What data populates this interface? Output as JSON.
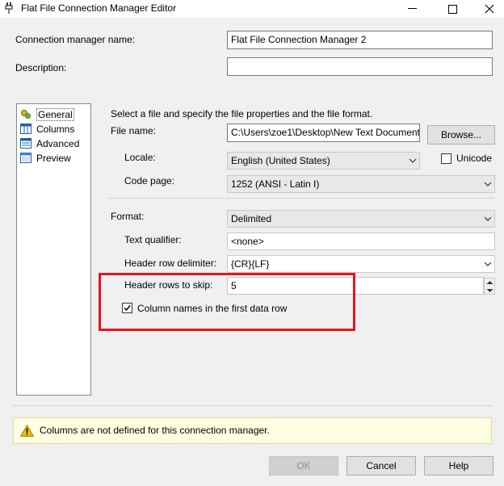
{
  "window": {
    "title": "Flat File Connection Manager Editor",
    "minimize_glyph": "—",
    "maximize_glyph": "☐",
    "close_glyph": "✕"
  },
  "form": {
    "name_label": "Connection manager name:",
    "name_value": "Flat File Connection Manager 2",
    "description_label": "Description:",
    "description_value": ""
  },
  "nav": {
    "items": [
      {
        "label": "General",
        "icon": "general-icon"
      },
      {
        "label": "Columns",
        "icon": "columns-icon"
      },
      {
        "label": "Advanced",
        "icon": "advanced-icon"
      },
      {
        "label": "Preview",
        "icon": "preview-icon"
      }
    ],
    "selected": "General"
  },
  "general": {
    "intro": "Select a file and specify the file properties and the file format.",
    "file_name_label": "File name:",
    "file_name_value": "C:\\Users\\zoe1\\Desktop\\New Text Document",
    "browse_label": "Browse...",
    "locale_label": "Locale:",
    "locale_value": "English (United States)",
    "unicode_label": "Unicode",
    "unicode_checked": false,
    "code_page_label": "Code page:",
    "code_page_value": "1252  (ANSI - Latin I)",
    "format_label": "Format:",
    "format_value": "Delimited",
    "text_qualifier_label": "Text qualifier:",
    "text_qualifier_value": "<none>",
    "header_row_delimiter_label": "Header row delimiter:",
    "header_row_delimiter_value": "{CR}{LF}",
    "header_rows_skip_label": "Header rows to skip:",
    "header_rows_skip_value": "5",
    "column_names_label": "Column names in the first data row",
    "column_names_checked": true
  },
  "warning": {
    "text": "Columns are not defined for this connection manager."
  },
  "buttons": {
    "ok": "OK",
    "cancel": "Cancel",
    "help": "Help"
  },
  "colors": {
    "highlight_border": "#e8141c",
    "warning_bg": "#ffffe1"
  }
}
